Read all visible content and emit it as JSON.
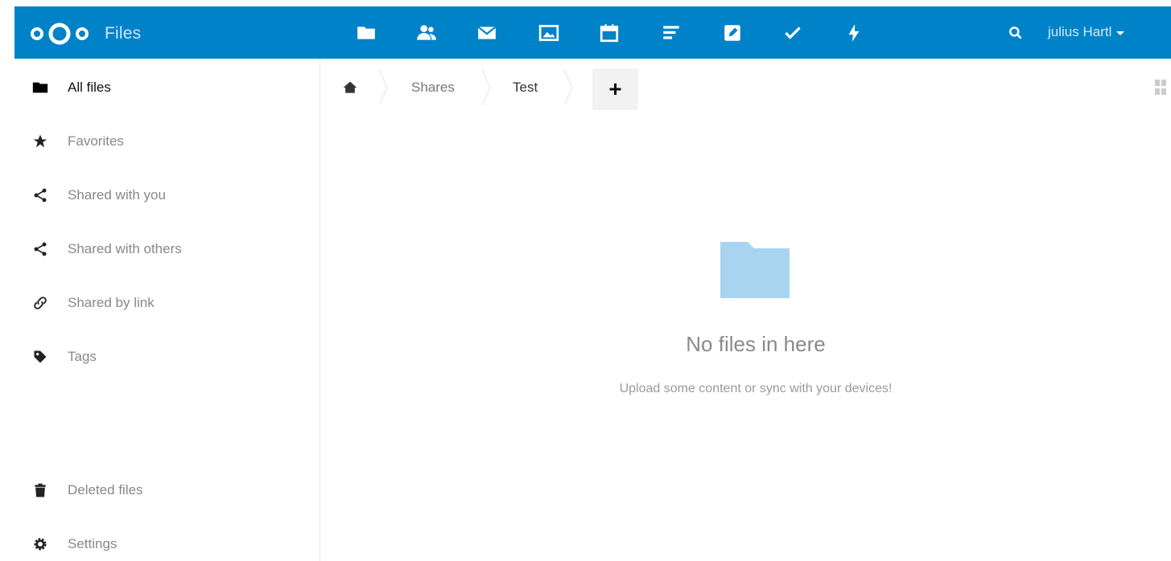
{
  "header": {
    "app_title": "Files",
    "accent_color": "#0082c9",
    "apps": [
      {
        "name": "files-app-icon"
      },
      {
        "name": "contacts-app-icon"
      },
      {
        "name": "mail-app-icon"
      },
      {
        "name": "gallery-app-icon"
      },
      {
        "name": "calendar-app-icon"
      },
      {
        "name": "notes-app-icon"
      },
      {
        "name": "edit-app-icon"
      },
      {
        "name": "tasks-app-icon"
      },
      {
        "name": "activity-app-icon"
      }
    ],
    "search_icon": "search-icon",
    "user_name": "julius Hartl"
  },
  "sidebar": {
    "items": [
      {
        "label": "All files",
        "icon": "folder-icon"
      },
      {
        "label": "Favorites",
        "icon": "star-icon"
      },
      {
        "label": "Shared with you",
        "icon": "share-icon"
      },
      {
        "label": "Shared with others",
        "icon": "share-icon"
      },
      {
        "label": "Shared by link",
        "icon": "link-icon"
      },
      {
        "label": "Tags",
        "icon": "tag-icon"
      }
    ],
    "bottom_items": [
      {
        "label": "Deleted files",
        "icon": "trash-icon"
      },
      {
        "label": "Settings",
        "icon": "gear-icon"
      }
    ]
  },
  "breadcrumb": {
    "home_icon": "home-icon",
    "crumbs": [
      "Shares",
      "Test"
    ],
    "new_label": "+"
  },
  "empty_state": {
    "title": "No files in here",
    "subtitle": "Upload some content or sync with your devices!",
    "folder_color": "#a8d4f0"
  }
}
